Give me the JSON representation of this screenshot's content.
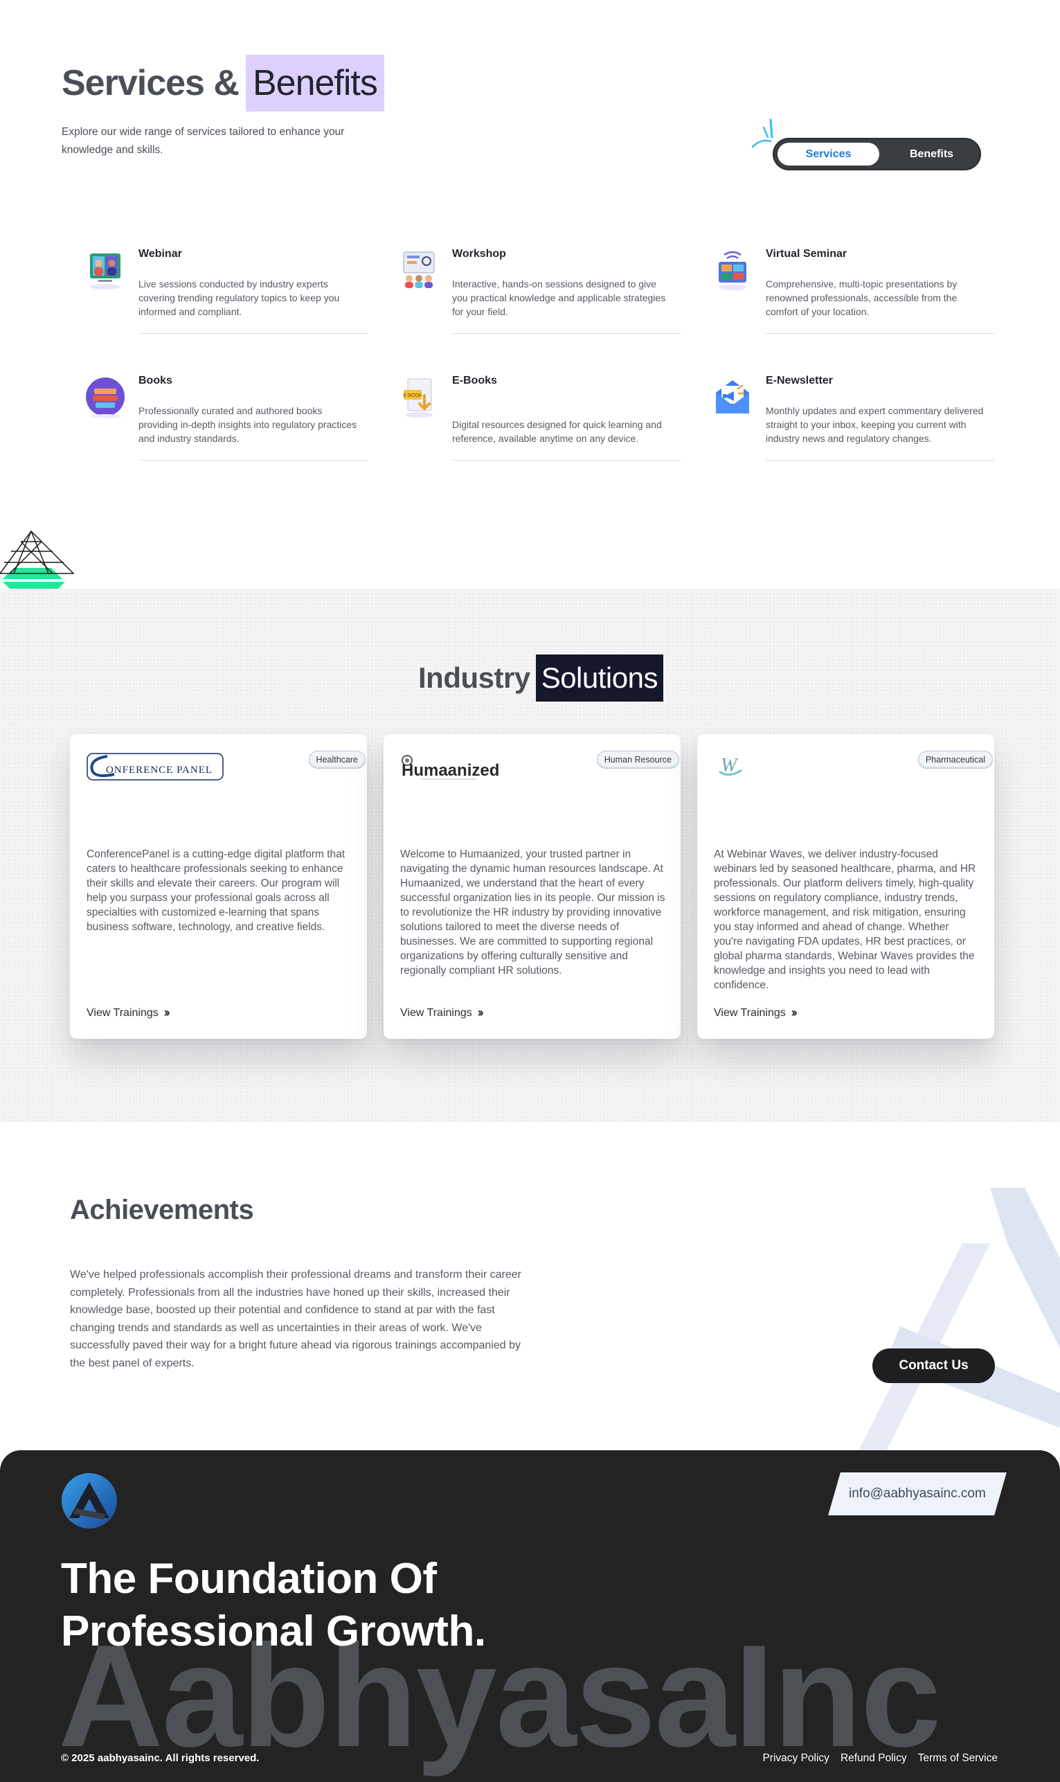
{
  "services": {
    "title_plain": "Services &",
    "title_highlight": "Benefits",
    "subtitle": "Explore our wide range of services tailored to enhance your knowledge and skills.",
    "toggle": {
      "active": "Services",
      "other": "Benefits"
    },
    "items": [
      {
        "name": "Webinar",
        "icon": "webinar-icon",
        "desc": "Live sessions conducted by industry experts covering trending regulatory topics to keep you informed and compliant."
      },
      {
        "name": "Workshop",
        "icon": "workshop-icon",
        "desc": "Interactive, hands-on sessions designed to give you practical knowledge and applicable strategies for your field."
      },
      {
        "name": "Virtual Seminar",
        "icon": "virtual-seminar-icon",
        "desc": "Comprehensive, multi-topic presentations by renowned professionals, accessible from the comfort of your location."
      },
      {
        "name": "Books",
        "icon": "books-icon",
        "desc": "Professionally curated and authored books providing in-depth insights into regulatory practices and industry standards."
      },
      {
        "name": "E-Books",
        "icon": "ebook-icon",
        "desc": "Digital resources designed for quick learning and reference, available anytime on any device."
      },
      {
        "name": "E-Newsletter",
        "icon": "newsletter-icon",
        "desc": "Monthly updates and expert commentary delivered straight to your inbox, keeping you current with industry news and regulatory changes."
      }
    ]
  },
  "industry": {
    "title_plain": "Industry",
    "title_highlight": "Solutions",
    "cards": [
      {
        "tag": "Healthcare",
        "logo_text": "ONFERENCE PANEL",
        "logo_initial": "C",
        "text": "ConferencePanel is a cutting-edge digital platform that caters to healthcare professionals seeking to enhance their skills and elevate their careers. Our program will help you surpass your professional goals across all specialties with customized e-learning that spans business software, technology, and creative fields.",
        "cta": "View Trainings"
      },
      {
        "tag": "Human Resource",
        "logo_text": "Humaanized",
        "text": "Welcome to Humaanized, your trusted partner in navigating the dynamic human resources landscape. At Humaanized, we understand that the heart of every successful organization lies in its people. Our mission is to revolutionize the HR industry by providing innovative solutions tailored to meet the diverse needs of businesses. We are committed to supporting regional organizations by offering culturally sensitive and regionally compliant HR solutions.",
        "cta": "View Trainings"
      },
      {
        "tag": "Pharmaceutical",
        "logo_text": "W",
        "text": "At Webinar Waves, we deliver industry-focused webinars led by seasoned healthcare, pharma, and HR professionals. Our platform delivers timely, high-quality sessions on regulatory compliance, industry trends, workforce management, and risk mitigation, ensuring you stay informed and ahead of change. Whether you're navigating FDA updates, HR best practices, or global pharma standards, Webinar Waves provides the knowledge and insights you need to lead with confidence.",
        "cta": "View Trainings"
      }
    ]
  },
  "achievements": {
    "title": "Achievements",
    "text": "We've helped professionals accomplish their professional dreams and transform their career completely. Professionals from all the industries have honed up their skills, increased their knowledge base, boosted up their potential and confidence to stand at par with the fast changing trends and standards as well as uncertainties in their areas of work. We've successfully paved their way for a bright future ahead via rigorous trainings accompanied by the best panel of experts.",
    "cta": "Contact Us"
  },
  "footer": {
    "email": "info@aabhyasainc.com",
    "tagline": "The Foundation Of Professional Growth.",
    "brand_watermark": "AabhyasaInc",
    "copyright": "© 2025 aabhyasainc. All rights reserved.",
    "links": [
      "Privacy Policy",
      "Refund Policy",
      "Terms of Service"
    ]
  },
  "colors": {
    "highlight_purple": "#ddd0ff",
    "highlight_navy": "#15172a",
    "toggle_active_text": "#1f7bd0",
    "footer_bg": "#232323"
  }
}
